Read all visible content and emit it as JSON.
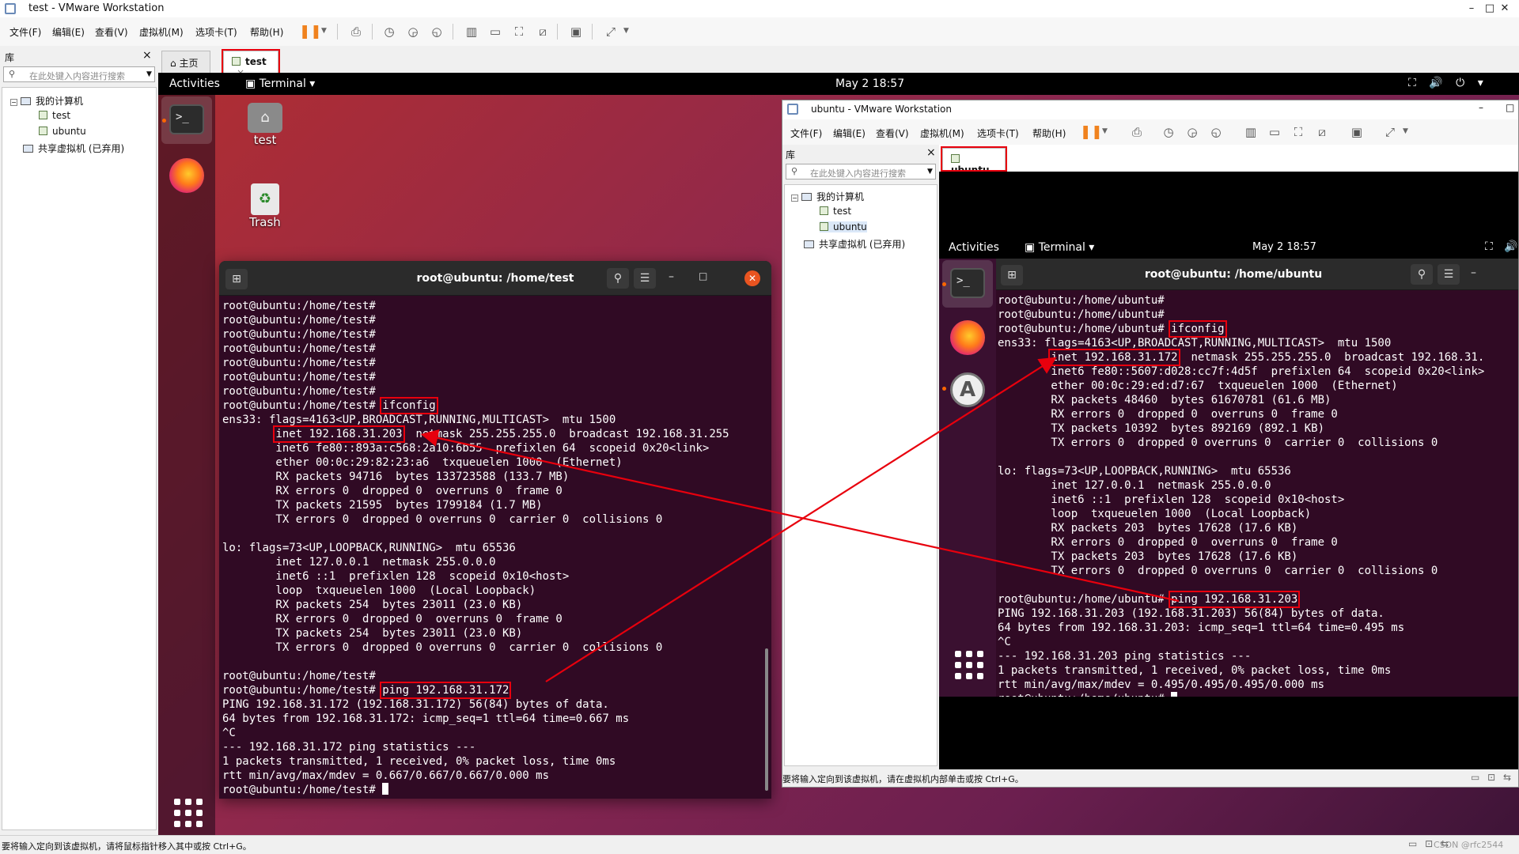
{
  "window": {
    "title": "test - VMware Workstation",
    "min": "–",
    "max": "□",
    "close": "✕"
  },
  "menu": [
    "文件(F)",
    "编辑(E)",
    "查看(V)",
    "虚拟机(M)",
    "选项卡(T)",
    "帮助(H)"
  ],
  "toolbar_icons": [
    "pause-icon",
    "send-keys-icon",
    "snapshot-icon",
    "revert-snapshot-icon",
    "snapshot-manager-icon",
    "show-library-icon",
    "thumbnail-icon",
    "full-screen-icon",
    "unity-icon",
    "console-icon",
    "stretch-icon"
  ],
  "library": {
    "title": "库",
    "close": "×",
    "search_placeholder": "在此处键入内容进行搜索",
    "root": "我的计算机",
    "vms": [
      "test",
      "ubuntu"
    ],
    "shared": "共享虚拟机 (已弃用)"
  },
  "tabs": [
    {
      "label": "主页"
    },
    {
      "label": "test",
      "active": true
    }
  ],
  "tab_close": "×",
  "gnome": {
    "activities": "Activities",
    "terminal_menu": "Terminal ▾",
    "clock": "May 2  18:57"
  },
  "desktop": {
    "home_label": "test",
    "trash_label": "Trash"
  },
  "term1": {
    "title": "root@ubuntu: /home/test",
    "lines": [
      "root@ubuntu:/home/test#",
      "root@ubuntu:/home/test#",
      "root@ubuntu:/home/test#",
      "root@ubuntu:/home/test#",
      "root@ubuntu:/home/test#",
      "root@ubuntu:/home/test#",
      "root@ubuntu:/home/test#",
      "root@ubuntu:/home/test# [[ifconfig]]",
      "ens33: flags=4163<UP,BROADCAST,RUNNING,MULTICAST>  mtu 1500",
      "        [[inet 192.168.31.203]]  netmask 255.255.255.0  broadcast 192.168.31.255",
      "        inet6 fe80::893a:c568:2a10:6b55  prefixlen 64  scopeid 0x20<link>",
      "        ether 00:0c:29:82:23:a6  txqueuelen 1000  (Ethernet)",
      "        RX packets 94716  bytes 133723588 (133.7 MB)",
      "        RX errors 0  dropped 0  overruns 0  frame 0",
      "        TX packets 21595  bytes 1799184 (1.7 MB)",
      "        TX errors 0  dropped 0 overruns 0  carrier 0  collisions 0",
      "",
      "lo: flags=73<UP,LOOPBACK,RUNNING>  mtu 65536",
      "        inet 127.0.0.1  netmask 255.0.0.0",
      "        inet6 ::1  prefixlen 128  scopeid 0x10<host>",
      "        loop  txqueuelen 1000  (Local Loopback)",
      "        RX packets 254  bytes 23011 (23.0 KB)",
      "        RX errors 0  dropped 0  overruns 0  frame 0",
      "        TX packets 254  bytes 23011 (23.0 KB)",
      "        TX errors 0  dropped 0 overruns 0  carrier 0  collisions 0",
      "",
      "root@ubuntu:/home/test#",
      "root@ubuntu:/home/test# [[ping 192.168.31.172]]",
      "PING 192.168.31.172 (192.168.31.172) 56(84) bytes of data.",
      "64 bytes from 192.168.31.172: icmp_seq=1 ttl=64 time=0.667 ms",
      "^C",
      "--- 192.168.31.172 ping statistics ---",
      "1 packets transmitted, 1 received, 0% packet loss, time 0ms",
      "rtt min/avg/max/mdev = 0.667/0.667/0.667/0.000 ms",
      "root@ubuntu:/home/test# {{cursor}}"
    ]
  },
  "vm2": {
    "title": "ubuntu - VMware Workstation",
    "tab": "ubuntu",
    "status": "要将输入定向到该虚拟机，请在虚拟机内部单击或按 Ctrl+G。"
  },
  "term2": {
    "title": "root@ubuntu: /home/ubuntu",
    "lines": [
      "root@ubuntu:/home/ubuntu#",
      "root@ubuntu:/home/ubuntu#",
      "root@ubuntu:/home/ubuntu# [[ifconfig]]",
      "ens33: flags=4163<UP,BROADCAST,RUNNING,MULTICAST>  mtu 1500",
      "        [[inet 192.168.31.172]]  netmask 255.255.255.0  broadcast 192.168.31.",
      "        inet6 fe80::5607:d028:cc7f:4d5f  prefixlen 64  scopeid 0x20<link>",
      "        ether 00:0c:29:ed:d7:67  txqueuelen 1000  (Ethernet)",
      "        RX packets 48460  bytes 61670781 (61.6 MB)",
      "        RX errors 0  dropped 0  overruns 0  frame 0",
      "        TX packets 10392  bytes 892169 (892.1 KB)",
      "        TX errors 0  dropped 0 overruns 0  carrier 0  collisions 0",
      "",
      "lo: flags=73<UP,LOOPBACK,RUNNING>  mtu 65536",
      "        inet 127.0.0.1  netmask 255.0.0.0",
      "        inet6 ::1  prefixlen 128  scopeid 0x10<host>",
      "        loop  txqueuelen 1000  (Local Loopback)",
      "        RX packets 203  bytes 17628 (17.6 KB)",
      "        RX errors 0  dropped 0  overruns 0  frame 0",
      "        TX packets 203  bytes 17628 (17.6 KB)",
      "        TX errors 0  dropped 0 overruns 0  carrier 0  collisions 0",
      "",
      "root@ubuntu:/home/ubuntu# [[ping 192.168.31.203]]",
      "PING 192.168.31.203 (192.168.31.203) 56(84) bytes of data.",
      "64 bytes from 192.168.31.203: icmp_seq=1 ttl=64 time=0.495 ms",
      "^C",
      "--- 192.168.31.203 ping statistics ---",
      "1 packets transmitted, 1 received, 0% packet loss, time 0ms",
      "rtt min/avg/max/mdev = 0.495/0.495/0.495/0.000 ms",
      "root@ubuntu:/home/ubuntu# {{cursor}}"
    ]
  },
  "status": {
    "text": "要将输入定向到该虚拟机，请将鼠标指针移入其中或按 Ctrl+G。",
    "watermark": "CSDN @rfc2544"
  },
  "colors": {
    "highlight": "#e8000d",
    "terminal_bg": "#300a24",
    "pause_accent": "#f0821e"
  }
}
